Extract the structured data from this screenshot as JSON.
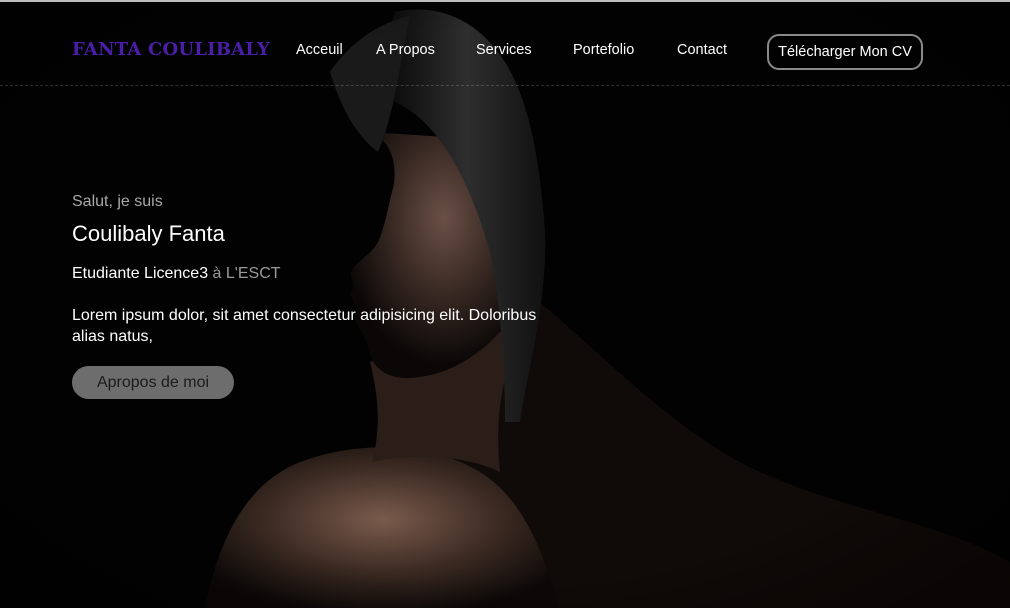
{
  "header": {
    "logo": "FANTA COULIBALY",
    "nav": [
      {
        "label": "Acceuil"
      },
      {
        "label": "A Propos"
      },
      {
        "label": "Services"
      },
      {
        "label": "Portefolio"
      },
      {
        "label": "Contact"
      }
    ],
    "cv_button": "Télécharger Mon CV"
  },
  "hero": {
    "greeting": "Salut, je suis",
    "name": "Coulibaly Fanta",
    "role_main": "Etudiante Licence3",
    "role_muted": " à L'ESCT",
    "description": "Lorem ipsum dolor, sit amet consectetur adipisicing elit. Doloribus alias natus,",
    "about_button": "Apropos de moi",
    "background_image": "portrait-photo"
  },
  "colors": {
    "background": "#000000",
    "logo": "#4a1fa8",
    "button_fill": "#6d6d6d",
    "button_border": "#8a8a8a"
  }
}
